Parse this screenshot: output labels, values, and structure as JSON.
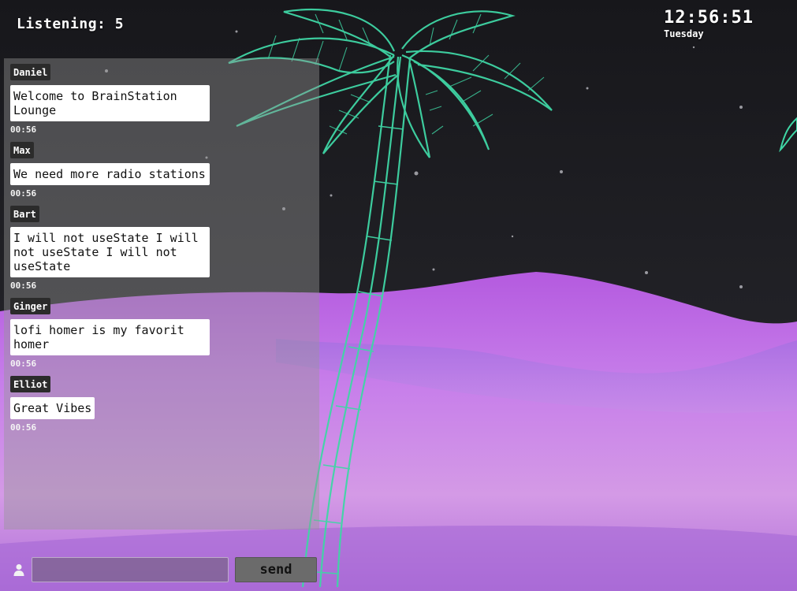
{
  "listening": "Listening: 5",
  "clock": {
    "time": "12:56:51",
    "day": "Tuesday"
  },
  "messages": [
    {
      "name": "Daniel",
      "text": "Welcome to BrainStation Lounge",
      "time": "00:56"
    },
    {
      "name": "Max",
      "text": "We need more radio stations",
      "time": "00:56"
    },
    {
      "name": "Bart",
      "text": "I will not useState I will not useState I will not useState",
      "time": "00:56"
    },
    {
      "name": "Ginger",
      "text": "lofi homer is my favorit homer",
      "time": "00:56"
    },
    {
      "name": "Elliot",
      "text": "Great Vibes",
      "time": "00:56"
    }
  ],
  "composer": {
    "input_value": "",
    "input_placeholder": "",
    "send_label": "send",
    "user_icon": "user-icon"
  },
  "colors": {
    "palm": "#3fd6a5",
    "desert": "#c878e6",
    "sky": "#1b1b1f"
  }
}
